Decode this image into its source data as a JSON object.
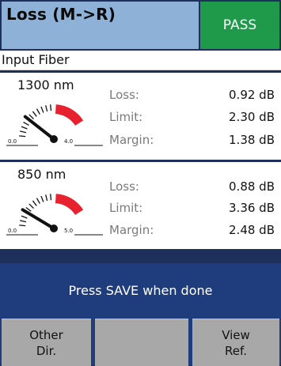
{
  "header": {
    "title": "Loss (M->R)",
    "status": "PASS"
  },
  "subtitle": "Input Fiber",
  "measurements": [
    {
      "wavelength": "1300 nm",
      "gauge": {
        "min_label": "0.0",
        "max_label": "4.0",
        "needle_fraction": 0.23
      },
      "rows": [
        {
          "label": "Loss:",
          "value": "0.92 dB"
        },
        {
          "label": "Limit:",
          "value": "2.30 dB"
        },
        {
          "label": "Margin:",
          "value": "1.38 dB"
        }
      ]
    },
    {
      "wavelength": "850 nm",
      "gauge": {
        "min_label": "0.0",
        "max_label": "5.0",
        "needle_fraction": 0.18
      },
      "rows": [
        {
          "label": "Loss:",
          "value": "0.88 dB"
        },
        {
          "label": "Limit:",
          "value": "3.36 dB"
        },
        {
          "label": "Margin:",
          "value": "2.48 dB"
        }
      ]
    }
  ],
  "prompt": "Press SAVE when done",
  "softkeys": [
    {
      "line1": "Other",
      "line2": "Dir."
    },
    {
      "line1": "",
      "line2": ""
    },
    {
      "line1": "View",
      "line2": "Ref."
    }
  ],
  "colors": {
    "header_title_bg": "#8eb1d7",
    "pass_bg": "#1f9a4a",
    "panel_frame": "#1f2f5c",
    "prompt_bg": "#1f3d7c",
    "softkey_bg": "#a8a8a8",
    "gauge_red": "#e8212e"
  },
  "icons": {
    "gauge": "dial-gauge-icon"
  }
}
